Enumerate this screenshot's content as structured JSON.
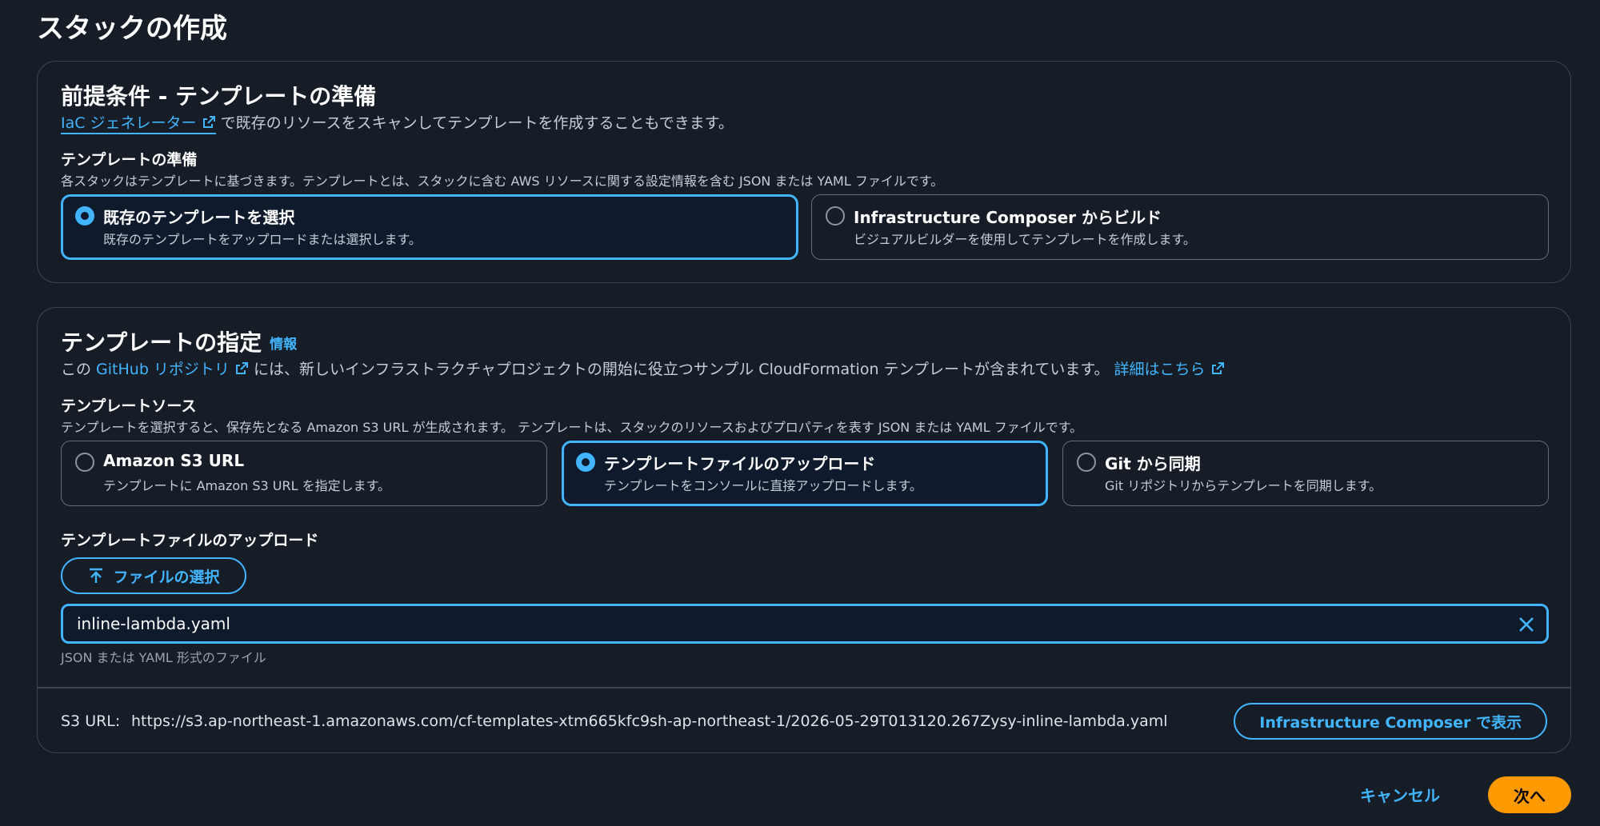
{
  "page": {
    "title": "スタックの作成"
  },
  "prerequisite": {
    "heading": "前提条件 - テンプレートの準備",
    "iac_link": "IaC ジェネレーター",
    "iac_text": " で既存のリソースをスキャンしてテンプレートを作成することもできます。",
    "prepare_label": "テンプレートの準備",
    "prepare_desc": "各スタックはテンプレートに基づきます。テンプレートとは、スタックに含む AWS リソースに関する設定情報を含む JSON または YAML ファイルです。",
    "options": [
      {
        "title": "既存のテンプレートを選択",
        "desc": "既存のテンプレートをアップロードまたは選択します。",
        "selected": true
      },
      {
        "title": "Infrastructure Composer からビルド",
        "desc": "ビジュアルビルダーを使用してテンプレートを作成します。",
        "selected": false
      }
    ]
  },
  "specify": {
    "heading": "テンプレートの指定",
    "info_link": "情報",
    "desc_prefix": "この ",
    "github_link": "GitHub リポジトリ",
    "desc_mid": " には、新しいインフラストラクチャプロジェクトの開始に役立つサンプル CloudFormation テンプレートが含まれています。 ",
    "details_link": "詳細はこちら",
    "source_label": "テンプレートソース",
    "source_desc": "テンプレートを選択すると、保存先となる Amazon S3 URL が生成されます。 テンプレートは、スタックのリソースおよびプロパティを表す JSON または YAML ファイルです。",
    "sources": [
      {
        "title": "Amazon S3 URL",
        "desc": "テンプレートに Amazon S3 URL を指定します。",
        "selected": false
      },
      {
        "title": "テンプレートファイルのアップロード",
        "desc": "テンプレートをコンソールに直接アップロードします。",
        "selected": true
      },
      {
        "title": "Git から同期",
        "desc": "Git リポジトリからテンプレートを同期します。",
        "selected": false
      }
    ],
    "upload_label": "テンプレートファイルのアップロード",
    "choose_file_label": "ファイルの選択",
    "file_name": "inline-lambda.yaml",
    "constraint": "JSON または YAML 形式のファイル",
    "s3_label": "S3 URL:",
    "s3_url": "https://s3.ap-northeast-1.amazonaws.com/cf-templates-xtm665kfc9sh-ap-northeast-1/2026-05-29T013120.267Zysy-inline-lambda.yaml",
    "composer_button": "Infrastructure Composer で表示"
  },
  "footer": {
    "cancel": "キャンセル",
    "next": "次へ"
  },
  "colors": {
    "accent": "#42b4ff",
    "primary_button": "#ff9900",
    "background": "#161d26"
  }
}
